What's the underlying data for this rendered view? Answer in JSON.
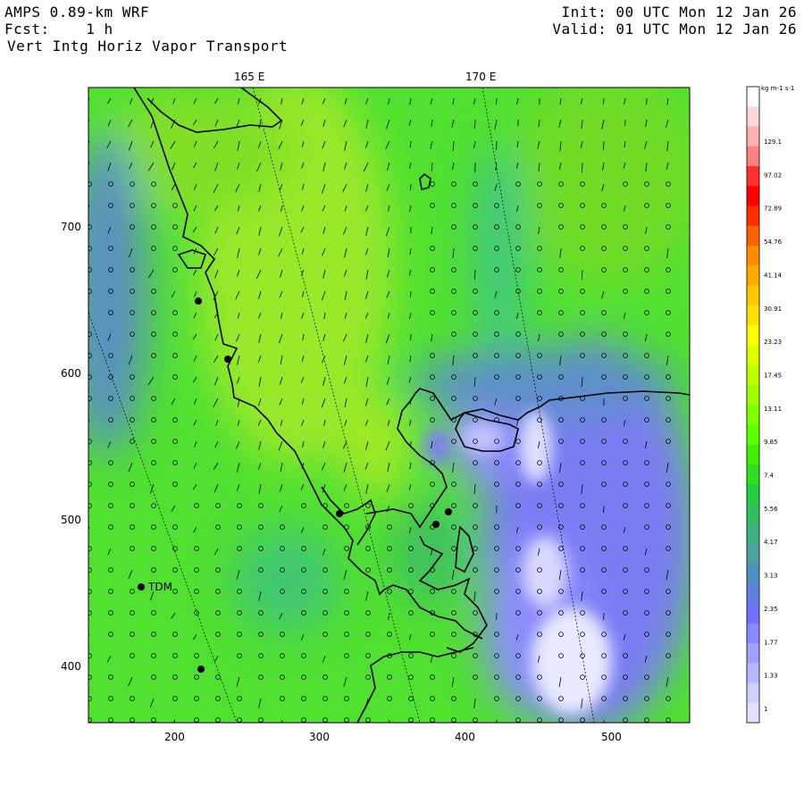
{
  "header": {
    "model": "AMPS 0.89-km WRF",
    "forecast": "Fcst:    1 h",
    "field": "Vert Intg Horiz Vapor Transport",
    "init": "Init: 00 UTC Mon 12 Jan 26",
    "valid": "Valid: 01 UTC Mon 12 Jan 26"
  },
  "longitude_labels": [
    "165 E",
    "170 E"
  ],
  "x_ticks": [
    "200",
    "300",
    "400",
    "500"
  ],
  "y_ticks": [
    "700",
    "600",
    "500",
    "400"
  ],
  "station": {
    "label": "TDM"
  },
  "colorbar": {
    "units": "kg m-1 s-1",
    "labels": [
      "129.1",
      "97.02",
      "72.89",
      "54.76",
      "41.14",
      "30.91",
      "23.23",
      "17.45",
      "13.11",
      "9.85",
      "7.4",
      "5.56",
      "4.17",
      "3.13",
      "2.35",
      "1.77",
      "1.33",
      "1"
    ],
    "colors": [
      "#ffffff",
      "#ffd8d8",
      "#ffb0b0",
      "#ff8080",
      "#ff3030",
      "#ff0000",
      "#ff3000",
      "#ff6000",
      "#ff8c00",
      "#ffaa00",
      "#ffc800",
      "#ffe000",
      "#ffff00",
      "#e0ff00",
      "#c0ff00",
      "#a0ff00",
      "#80ff00",
      "#60ff00",
      "#40f000",
      "#30e020",
      "#20d040",
      "#30c060",
      "#40b080",
      "#50a0a0",
      "#5090c0",
      "#6080e0",
      "#7070ff",
      "#8888ff",
      "#a0a0ff",
      "#b8b8ff",
      "#d0d0ff",
      "#e0e0ff"
    ]
  }
}
